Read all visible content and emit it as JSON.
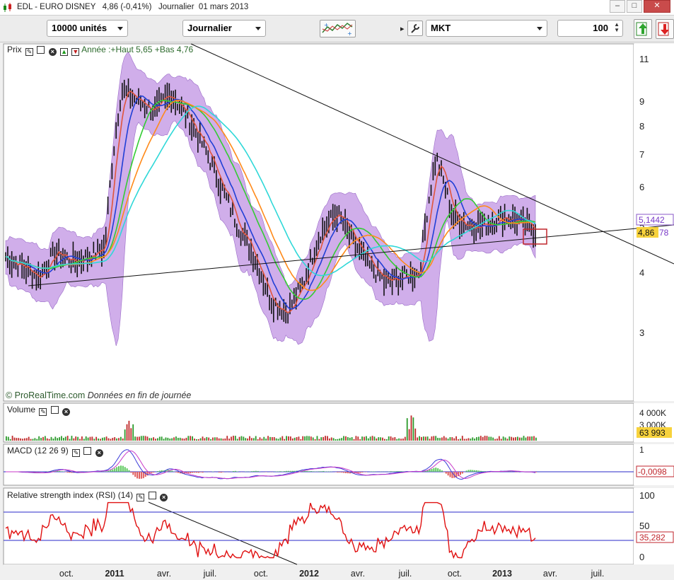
{
  "window": {
    "title": "EDL - EURO DISNEY   4,86 (-0,41%)   Journalier  01 mars 2013",
    "controls": {
      "minimize": "–",
      "maximize": "□",
      "close": "✕"
    }
  },
  "toolbar": {
    "quantity": "10000 unités",
    "period": "Journalier",
    "expand_glyph": "▸",
    "order_type": "MKT",
    "order_qty": "100",
    "spin_up": "▲",
    "spin_down": "▼",
    "icons": [
      "chart-indicators-icon",
      "wrench-icon",
      "buy-icon",
      "sell-icon"
    ]
  },
  "price_panel": {
    "label": "Prix",
    "annotation": "Année :+Haut 5,65 +Bas 4,76",
    "copyright": "© ProRealTime.com",
    "copyright_note": "Données en fin de journée",
    "y_ticks": [
      "11",
      "9",
      "8",
      "7",
      "6",
      "5",
      "4",
      "3"
    ],
    "last_price_label": "4,86",
    "last_price_suffix": "78",
    "bb_value_label": "5,1442"
  },
  "volume_panel": {
    "label": "Volume",
    "y_ticks": [
      "4 000K",
      "3 000K"
    ],
    "last_value_label": "63 993"
  },
  "macd_panel": {
    "label": "MACD (12 26 9)",
    "y_ticks": [
      "1",
      "0"
    ],
    "last_value_label": "-0,0098"
  },
  "rsi_panel": {
    "label": "Relative strength index (RSI) (14)",
    "y_ticks": [
      "100",
      "50",
      "0"
    ],
    "last_value_label": "35,282"
  },
  "x_axis": {
    "labels": [
      "oct.",
      "2011",
      "avr.",
      "juil.",
      "oct.",
      "2012",
      "avr.",
      "juil.",
      "oct.",
      "2013",
      "avr.",
      "juil."
    ],
    "bold_labels": [
      "2011",
      "2012",
      "2013"
    ]
  },
  "colors": {
    "bollinger": "#c8a0e6",
    "price_bars": "#111111",
    "ma_fast_red": "#e0553b",
    "ma_blue": "#1f3fd6",
    "ma_green": "#33cc33",
    "ma_orange": "#ff8a1a",
    "ma_cyan": "#2fd8d8",
    "rsi": "#e01010",
    "guide_lines": "#2a2ac8",
    "highlight_box": "#c0262c",
    "price_tag_bg": "#f7d23c"
  },
  "chart_data": {
    "type": "line",
    "instrument": "EDL - EURO DISNEY",
    "interval": "Journalier",
    "date_range": [
      "2010-07",
      "2013-03"
    ],
    "price_scale": "log",
    "price_ylim": [
      2.2,
      11.5
    ],
    "price_series": [
      {
        "date": "2010-07",
        "value": 4.3
      },
      {
        "date": "2010-08",
        "value": 4.1
      },
      {
        "date": "2010-09",
        "value": 3.9
      },
      {
        "date": "2010-10",
        "value": 4.4
      },
      {
        "date": "2010-11",
        "value": 4.2
      },
      {
        "date": "2010-12",
        "value": 4.3
      },
      {
        "date": "2011-01",
        "value": 4.5
      },
      {
        "date": "2011-02",
        "value": 9.5
      },
      {
        "date": "2011-03",
        "value": 9.0
      },
      {
        "date": "2011-04",
        "value": 8.6
      },
      {
        "date": "2011-05",
        "value": 9.3
      },
      {
        "date": "2011-06",
        "value": 8.3
      },
      {
        "date": "2011-07",
        "value": 7.2
      },
      {
        "date": "2011-08",
        "value": 6.0
      },
      {
        "date": "2011-09",
        "value": 5.0
      },
      {
        "date": "2011-10",
        "value": 4.3
      },
      {
        "date": "2011-11",
        "value": 3.5
      },
      {
        "date": "2011-12",
        "value": 3.3
      },
      {
        "date": "2012-01",
        "value": 3.8
      },
      {
        "date": "2012-02",
        "value": 4.8
      },
      {
        "date": "2012-03",
        "value": 5.3
      },
      {
        "date": "2012-04",
        "value": 4.6
      },
      {
        "date": "2012-05",
        "value": 4.1
      },
      {
        "date": "2012-06",
        "value": 3.8
      },
      {
        "date": "2012-07",
        "value": 3.9
      },
      {
        "date": "2012-08",
        "value": 4.0
      },
      {
        "date": "2012-09",
        "value": 6.9
      },
      {
        "date": "2012-10",
        "value": 5.2
      },
      {
        "date": "2012-11",
        "value": 5.0
      },
      {
        "date": "2012-12",
        "value": 5.0
      },
      {
        "date": "2013-01",
        "value": 5.2
      },
      {
        "date": "2013-02",
        "value": 5.1
      },
      {
        "date": "2013-03",
        "value": 4.86
      }
    ],
    "year_extremes": {
      "high": 5.65,
      "low": 4.76
    },
    "last_close": 4.86,
    "last_change_pct": -0.41,
    "last_volume": 63993,
    "macd_last": -0.0098,
    "rsi_last": 35.282,
    "rsi_levels": [
      70,
      30
    ]
  }
}
